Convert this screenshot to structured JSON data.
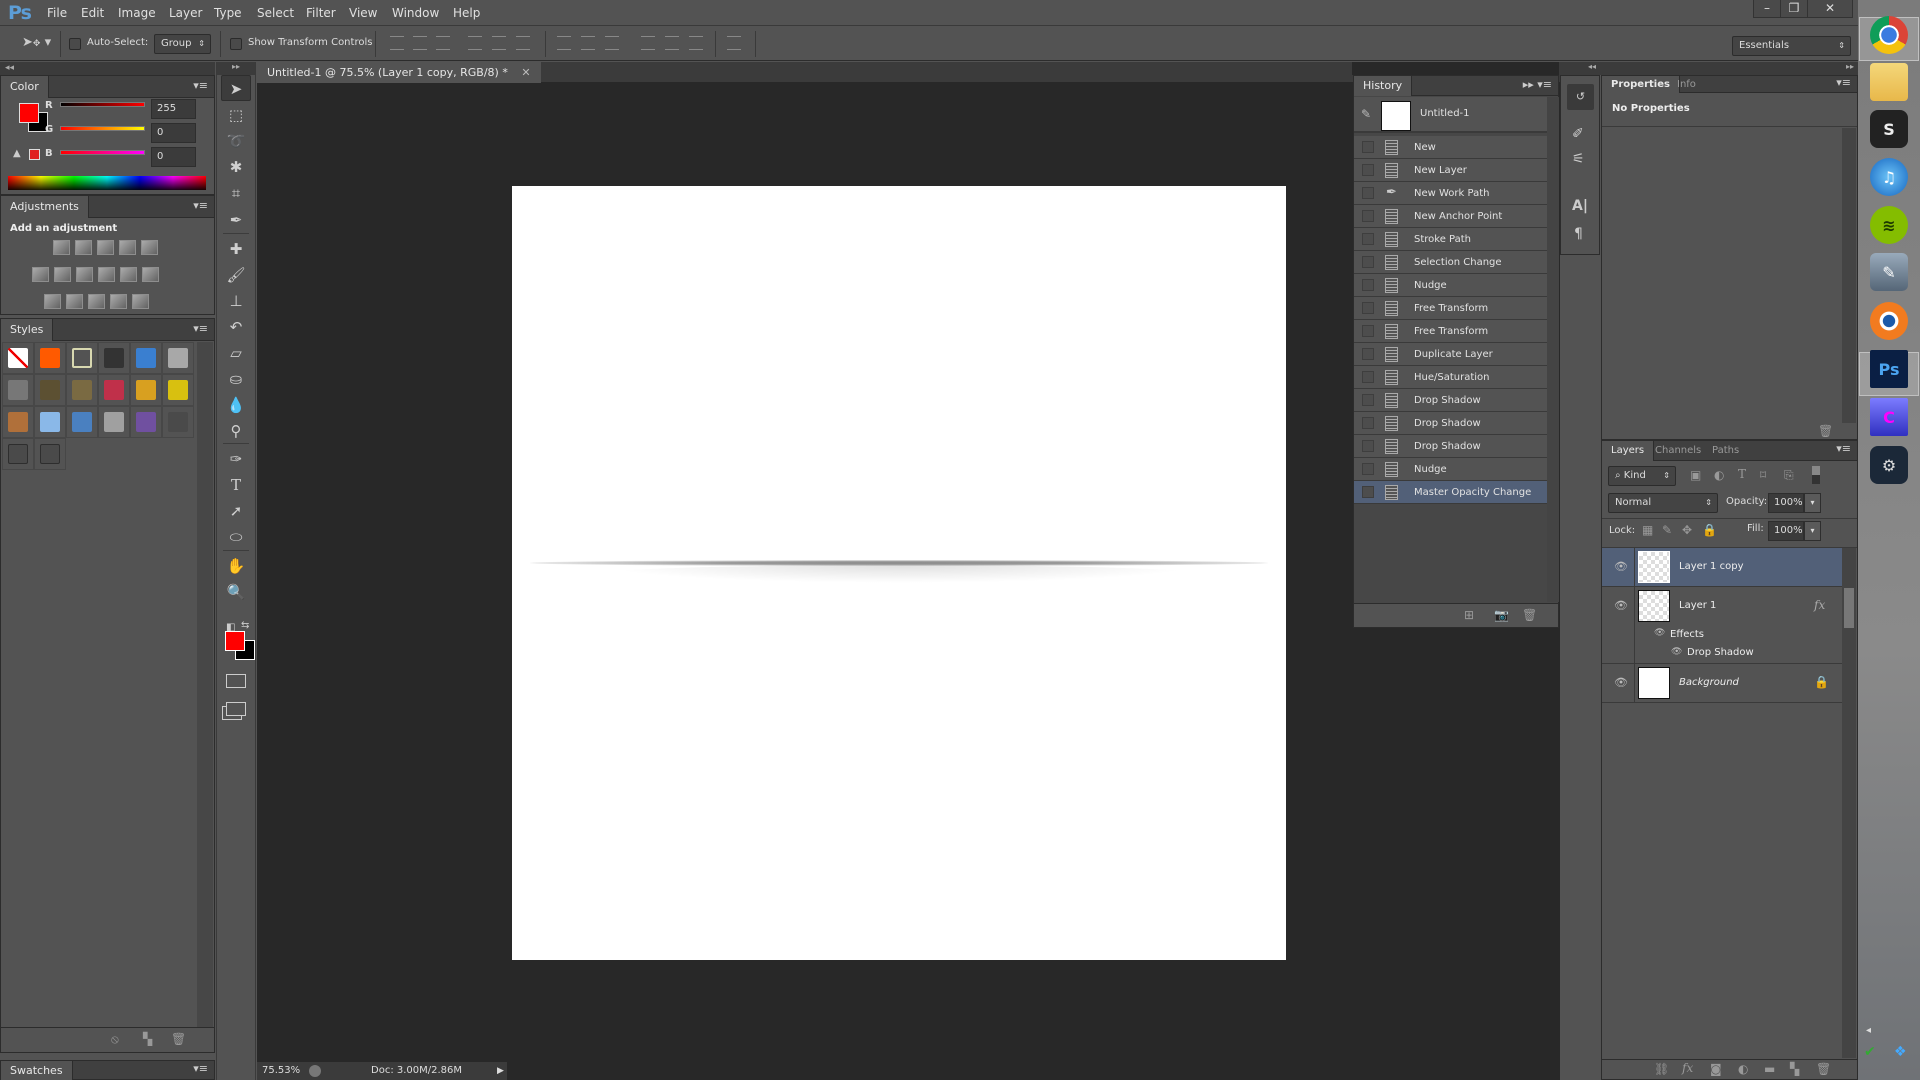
{
  "app": {
    "logo": "Ps"
  },
  "menu": [
    "File",
    "Edit",
    "Image",
    "Layer",
    "Type",
    "Select",
    "Filter",
    "View",
    "Window",
    "Help"
  ],
  "window_controls": {
    "minimize": "–",
    "restore": "❐",
    "close": "✕"
  },
  "options_bar": {
    "tool_icon": "move-tool-icon",
    "auto_select_label": "Auto-Select:",
    "auto_select_checked": false,
    "auto_select_target": "Group",
    "show_transform_label": "Show Transform Controls",
    "show_transform_checked": false,
    "workspace": "Essentials"
  },
  "color_panel": {
    "tab": "Color",
    "foreground": "#ff0000",
    "background": "#000000",
    "channels": [
      {
        "label": "R",
        "value": "255"
      },
      {
        "label": "G",
        "value": "0"
      },
      {
        "label": "B",
        "value": "0"
      }
    ]
  },
  "adjustments_panel": {
    "tab": "Adjustments",
    "heading": "Add an adjustment",
    "icons": [
      [
        "brightness-contrast-icon",
        "levels-icon",
        "curves-icon",
        "exposure-icon",
        "vibrance-icon"
      ],
      [
        "hue-saturation-icon",
        "color-balance-icon",
        "black-white-icon",
        "photo-filter-icon",
        "channel-mixer-icon",
        "color-lookup-icon"
      ],
      [
        "invert-icon",
        "posterize-icon",
        "threshold-icon",
        "selective-color-icon",
        "gradient-map-icon"
      ]
    ]
  },
  "styles_panel": {
    "tab": "Styles",
    "swatches": [
      "#ffffff",
      "#ff5a00",
      "#5a5a5a",
      "#333333",
      "#3a7fd0",
      "#a8a8a8",
      "#777777",
      "#5c5032",
      "#7a6a42",
      "#c0304a",
      "#d8a020",
      "#d8c010",
      "#b0703a",
      "#8ab8e8",
      "#4a80c0",
      "#a0a0a0",
      "#7050a0",
      "#4a4a4a",
      "#4a4a4a",
      "#4a4a4a"
    ]
  },
  "swatches_panel": {
    "tab": "Swatches"
  },
  "toolbox": [
    "move",
    "marquee",
    "lasso",
    "magic-wand",
    "crop",
    "eyedropper",
    "healing-brush",
    "brush",
    "clone-stamp",
    "history-brush",
    "eraser",
    "paint-bucket",
    "blur",
    "dodge",
    "pen",
    "type",
    "path-selection",
    "ellipse",
    "hand",
    "zoom"
  ],
  "document": {
    "tab_title": "Untitled-1 @ 75.5% (Layer 1 copy, RGB/8) *",
    "zoom": "75.53%",
    "doc_size": "Doc: 3.00M/2.86M"
  },
  "history_panel": {
    "tab": "History",
    "snapshot": "Untitled-1",
    "items": [
      {
        "label": "New",
        "icon": "doc"
      },
      {
        "label": "New Layer",
        "icon": "doc"
      },
      {
        "label": "New Work Path",
        "icon": "pen"
      },
      {
        "label": "New Anchor Point",
        "icon": "doc"
      },
      {
        "label": "Stroke Path",
        "icon": "doc"
      },
      {
        "label": "Selection Change",
        "icon": "doc"
      },
      {
        "label": "Nudge",
        "icon": "doc"
      },
      {
        "label": "Free Transform",
        "icon": "doc"
      },
      {
        "label": "Free Transform",
        "icon": "doc"
      },
      {
        "label": "Duplicate Layer",
        "icon": "doc"
      },
      {
        "label": "Hue/Saturation",
        "icon": "doc"
      },
      {
        "label": "Drop Shadow",
        "icon": "doc"
      },
      {
        "label": "Drop Shadow",
        "icon": "doc"
      },
      {
        "label": "Drop Shadow",
        "icon": "doc"
      },
      {
        "label": "Nudge",
        "icon": "doc"
      },
      {
        "label": "Master Opacity Change",
        "icon": "doc",
        "selected": true
      }
    ]
  },
  "properties_panel": {
    "tabs": [
      "Properties",
      "Info"
    ],
    "message": "No Properties"
  },
  "layers_panel": {
    "tabs": [
      "Layers",
      "Channels",
      "Paths"
    ],
    "filter": "Kind",
    "blend_mode": "Normal",
    "opacity_label": "Opacity:",
    "opacity": "100%",
    "lock_label": "Lock:",
    "fill_label": "Fill:",
    "fill": "100%",
    "layers": [
      {
        "name": "Layer 1 copy",
        "selected": true,
        "transparent": true
      },
      {
        "name": "Layer 1",
        "transparent": true,
        "fx": "fx",
        "effects_label": "Effects",
        "effect": "Drop Shadow"
      },
      {
        "name": "Background",
        "locked": true,
        "italic": true
      }
    ]
  },
  "dock": [
    "Chrome",
    "File Explorer",
    "Scrivener",
    "iTunes",
    "Spotify",
    "Sketch",
    "Blender",
    "Photoshop",
    "Canvas",
    "Steam"
  ],
  "accent": "#526078"
}
